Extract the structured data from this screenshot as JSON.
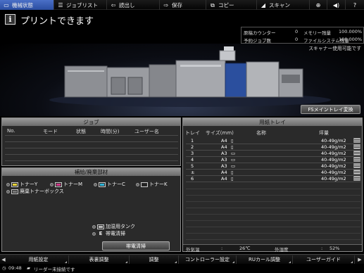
{
  "topbar": {
    "tabs": [
      {
        "label": "機械状態",
        "icon": "machine-icon"
      },
      {
        "label": "ジョブリスト",
        "icon": "joblist-icon"
      },
      {
        "label": "読出し",
        "icon": "recall-icon"
      },
      {
        "label": "保存",
        "icon": "store-icon"
      },
      {
        "label": "コピー",
        "icon": "copy-icon"
      },
      {
        "label": "スキャン",
        "icon": "scan-icon"
      }
    ],
    "icons": [
      "globe-icon",
      "volume-icon",
      "help-icon"
    ]
  },
  "header": {
    "status_title": "プリントできます",
    "counters": [
      {
        "label": "原稿カウンター",
        "value": "0",
        "label2": "メモリー残量",
        "value2": "100.000%"
      },
      {
        "label": "予約ジョブ数",
        "value": "0",
        "label2": "ファイルシステム残量",
        "value2": "100.000%"
      }
    ],
    "scanner_status": "スキャナー使用可能です"
  },
  "machine": {
    "fs_button": "FSメイントレイ変換"
  },
  "job_panel": {
    "title": "ジョブ",
    "columns": [
      "No.",
      "モード",
      "状態",
      "時間(分)",
      "ユーザー名"
    ]
  },
  "supply_panel": {
    "title": "補給/廃棄部材",
    "toners": [
      {
        "label": "トナーY",
        "color": "#e6d23a"
      },
      {
        "label": "トナーM",
        "color": "#d23a8a"
      },
      {
        "label": "トナーC",
        "color": "#2fb5d8"
      },
      {
        "label": "トナーK",
        "color": "#222222"
      }
    ],
    "waste_toner": "廃棄トナーボックス",
    "humidifier_tank": "加湿用タンク",
    "charge_clean_status": "帯電清掃",
    "charge_clean_button": "帯電清掃"
  },
  "tray_panel": {
    "title": "用紙トレイ",
    "columns": [
      "トレイ",
      "サイズ(mm)",
      "名称",
      "坪量"
    ],
    "rows": [
      {
        "tray": "1",
        "size": "A4",
        "weight": "40-49g/m2"
      },
      {
        "tray": "2",
        "size": "A4",
        "weight": "40-49g/m2"
      },
      {
        "tray": "3",
        "size": "A3",
        "weight": "40-49g/m2"
      },
      {
        "tray": "4",
        "size": "A3",
        "weight": "40-49g/m2"
      },
      {
        "tray": "5",
        "size": "A3",
        "weight": "40-49g/m2"
      },
      {
        "tray": "±",
        "size": "A4",
        "weight": "40-49g/m2"
      },
      {
        "tray": "6",
        "size": "A4",
        "weight": "40-49g/m2"
      }
    ],
    "outside_temp_label": "外気温",
    "outside_temp_value": "26℃",
    "outside_humidity_label": "外湿度",
    "outside_humidity_value": "52%"
  },
  "bottombar": {
    "buttons": [
      "用紙設定",
      "表裏調整",
      "調整",
      "コントローラー設定",
      "RUカール調整",
      "ユーザーガイド"
    ]
  },
  "statusline": {
    "time": "09:48",
    "message": "リーダー未接続です"
  }
}
